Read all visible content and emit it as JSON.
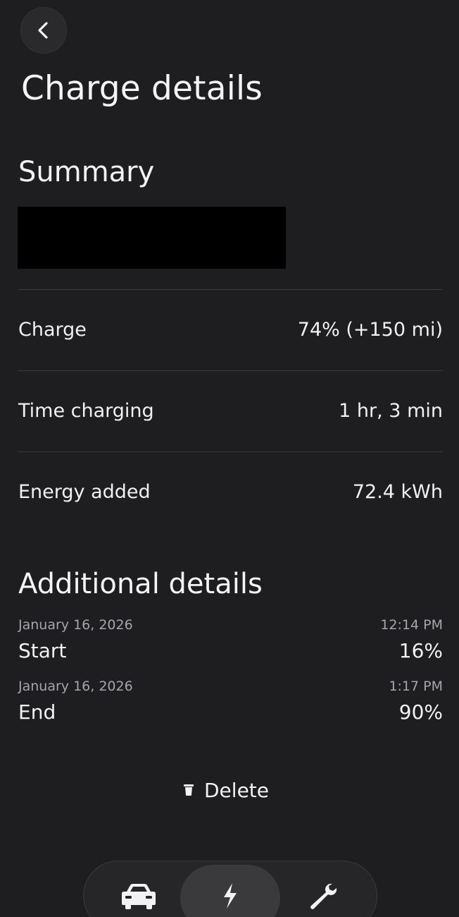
{
  "header": {
    "title": "Charge details"
  },
  "summary": {
    "title": "Summary",
    "rows": [
      {
        "label": "Charge",
        "value": "74% (+150 mi)"
      },
      {
        "label": "Time charging",
        "value": "1 hr, 3 min"
      },
      {
        "label": "Energy added",
        "value": "72.4 kWh"
      }
    ]
  },
  "additional": {
    "title": "Additional details",
    "start": {
      "date": "January 16, 2026",
      "time": "12:14 PM",
      "label": "Start",
      "value": "16%"
    },
    "end": {
      "date": "January 16, 2026",
      "time": "1:17 PM",
      "label": "End",
      "value": "90%"
    }
  },
  "actions": {
    "delete_label": "Delete"
  },
  "nav": {
    "items": [
      {
        "icon": "car-icon",
        "active": false
      },
      {
        "icon": "lightning-bolt-icon",
        "active": true
      },
      {
        "icon": "wrench-icon",
        "active": false
      }
    ]
  },
  "colors": {
    "background": "#1e1e20",
    "text": "#f2f2f2",
    "muted": "#a6a6aa",
    "divider": "#3a3a3d",
    "active_nav": "#3a3a3d"
  }
}
